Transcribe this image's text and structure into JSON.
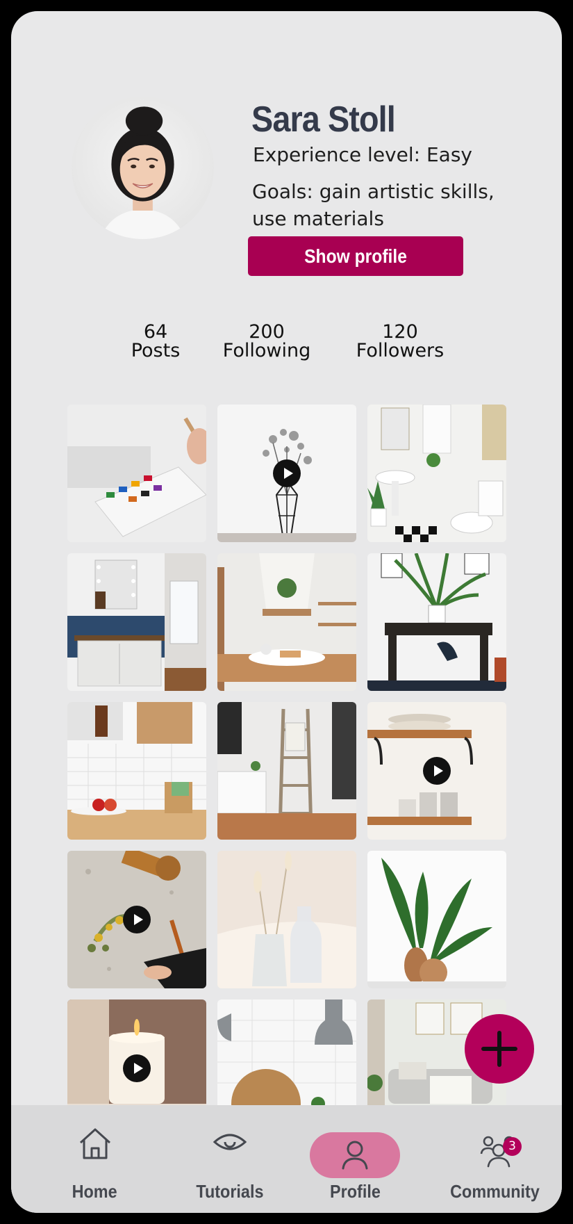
{
  "profile": {
    "name": "Sara Stoll",
    "experience": "Experience level: Easy",
    "goals": "Goals: gain artistic skills, use materials",
    "show_profile_label": "Show profile"
  },
  "stats": [
    {
      "value": "64",
      "label": "Posts"
    },
    {
      "value": "200",
      "label": "Following"
    },
    {
      "value": "120",
      "label": "Followers"
    }
  ],
  "posts": [
    {
      "subject": "watercolor palette",
      "video": false
    },
    {
      "subject": "dried flowers in wire vase",
      "video": true
    },
    {
      "subject": "white bathroom",
      "video": false
    },
    {
      "subject": "bathroom vanity with mirror",
      "video": false
    },
    {
      "subject": "rustic kitchen",
      "video": false
    },
    {
      "subject": "desk with palm plant",
      "video": false
    },
    {
      "subject": "kitchen counter with tiles",
      "video": false
    },
    {
      "subject": "ladder shelf living room",
      "video": false
    },
    {
      "subject": "wooden wall shelf",
      "video": true
    },
    {
      "subject": "dried flower wreath",
      "video": true
    },
    {
      "subject": "glass vases with pampas",
      "video": false
    },
    {
      "subject": "plant in wooden vases",
      "video": false
    },
    {
      "subject": "candle",
      "video": true
    },
    {
      "subject": "woven basket kitchen",
      "video": false
    },
    {
      "subject": "living room sofa",
      "video": false
    }
  ],
  "nav": {
    "items": [
      {
        "label": "Home",
        "icon": "home-icon"
      },
      {
        "label": "Tutorials",
        "icon": "eye-icon"
      },
      {
        "label": "Profile",
        "icon": "user-icon",
        "active": true
      },
      {
        "label": "Community",
        "icon": "users-icon",
        "badge": "3"
      }
    ]
  },
  "colors": {
    "accent": "#b3005a",
    "button": "#a80052",
    "active_pill": "#d9789f",
    "background": "#e8e8e9",
    "nav_background": "#d9d9da",
    "name_text": "#343a4a"
  }
}
